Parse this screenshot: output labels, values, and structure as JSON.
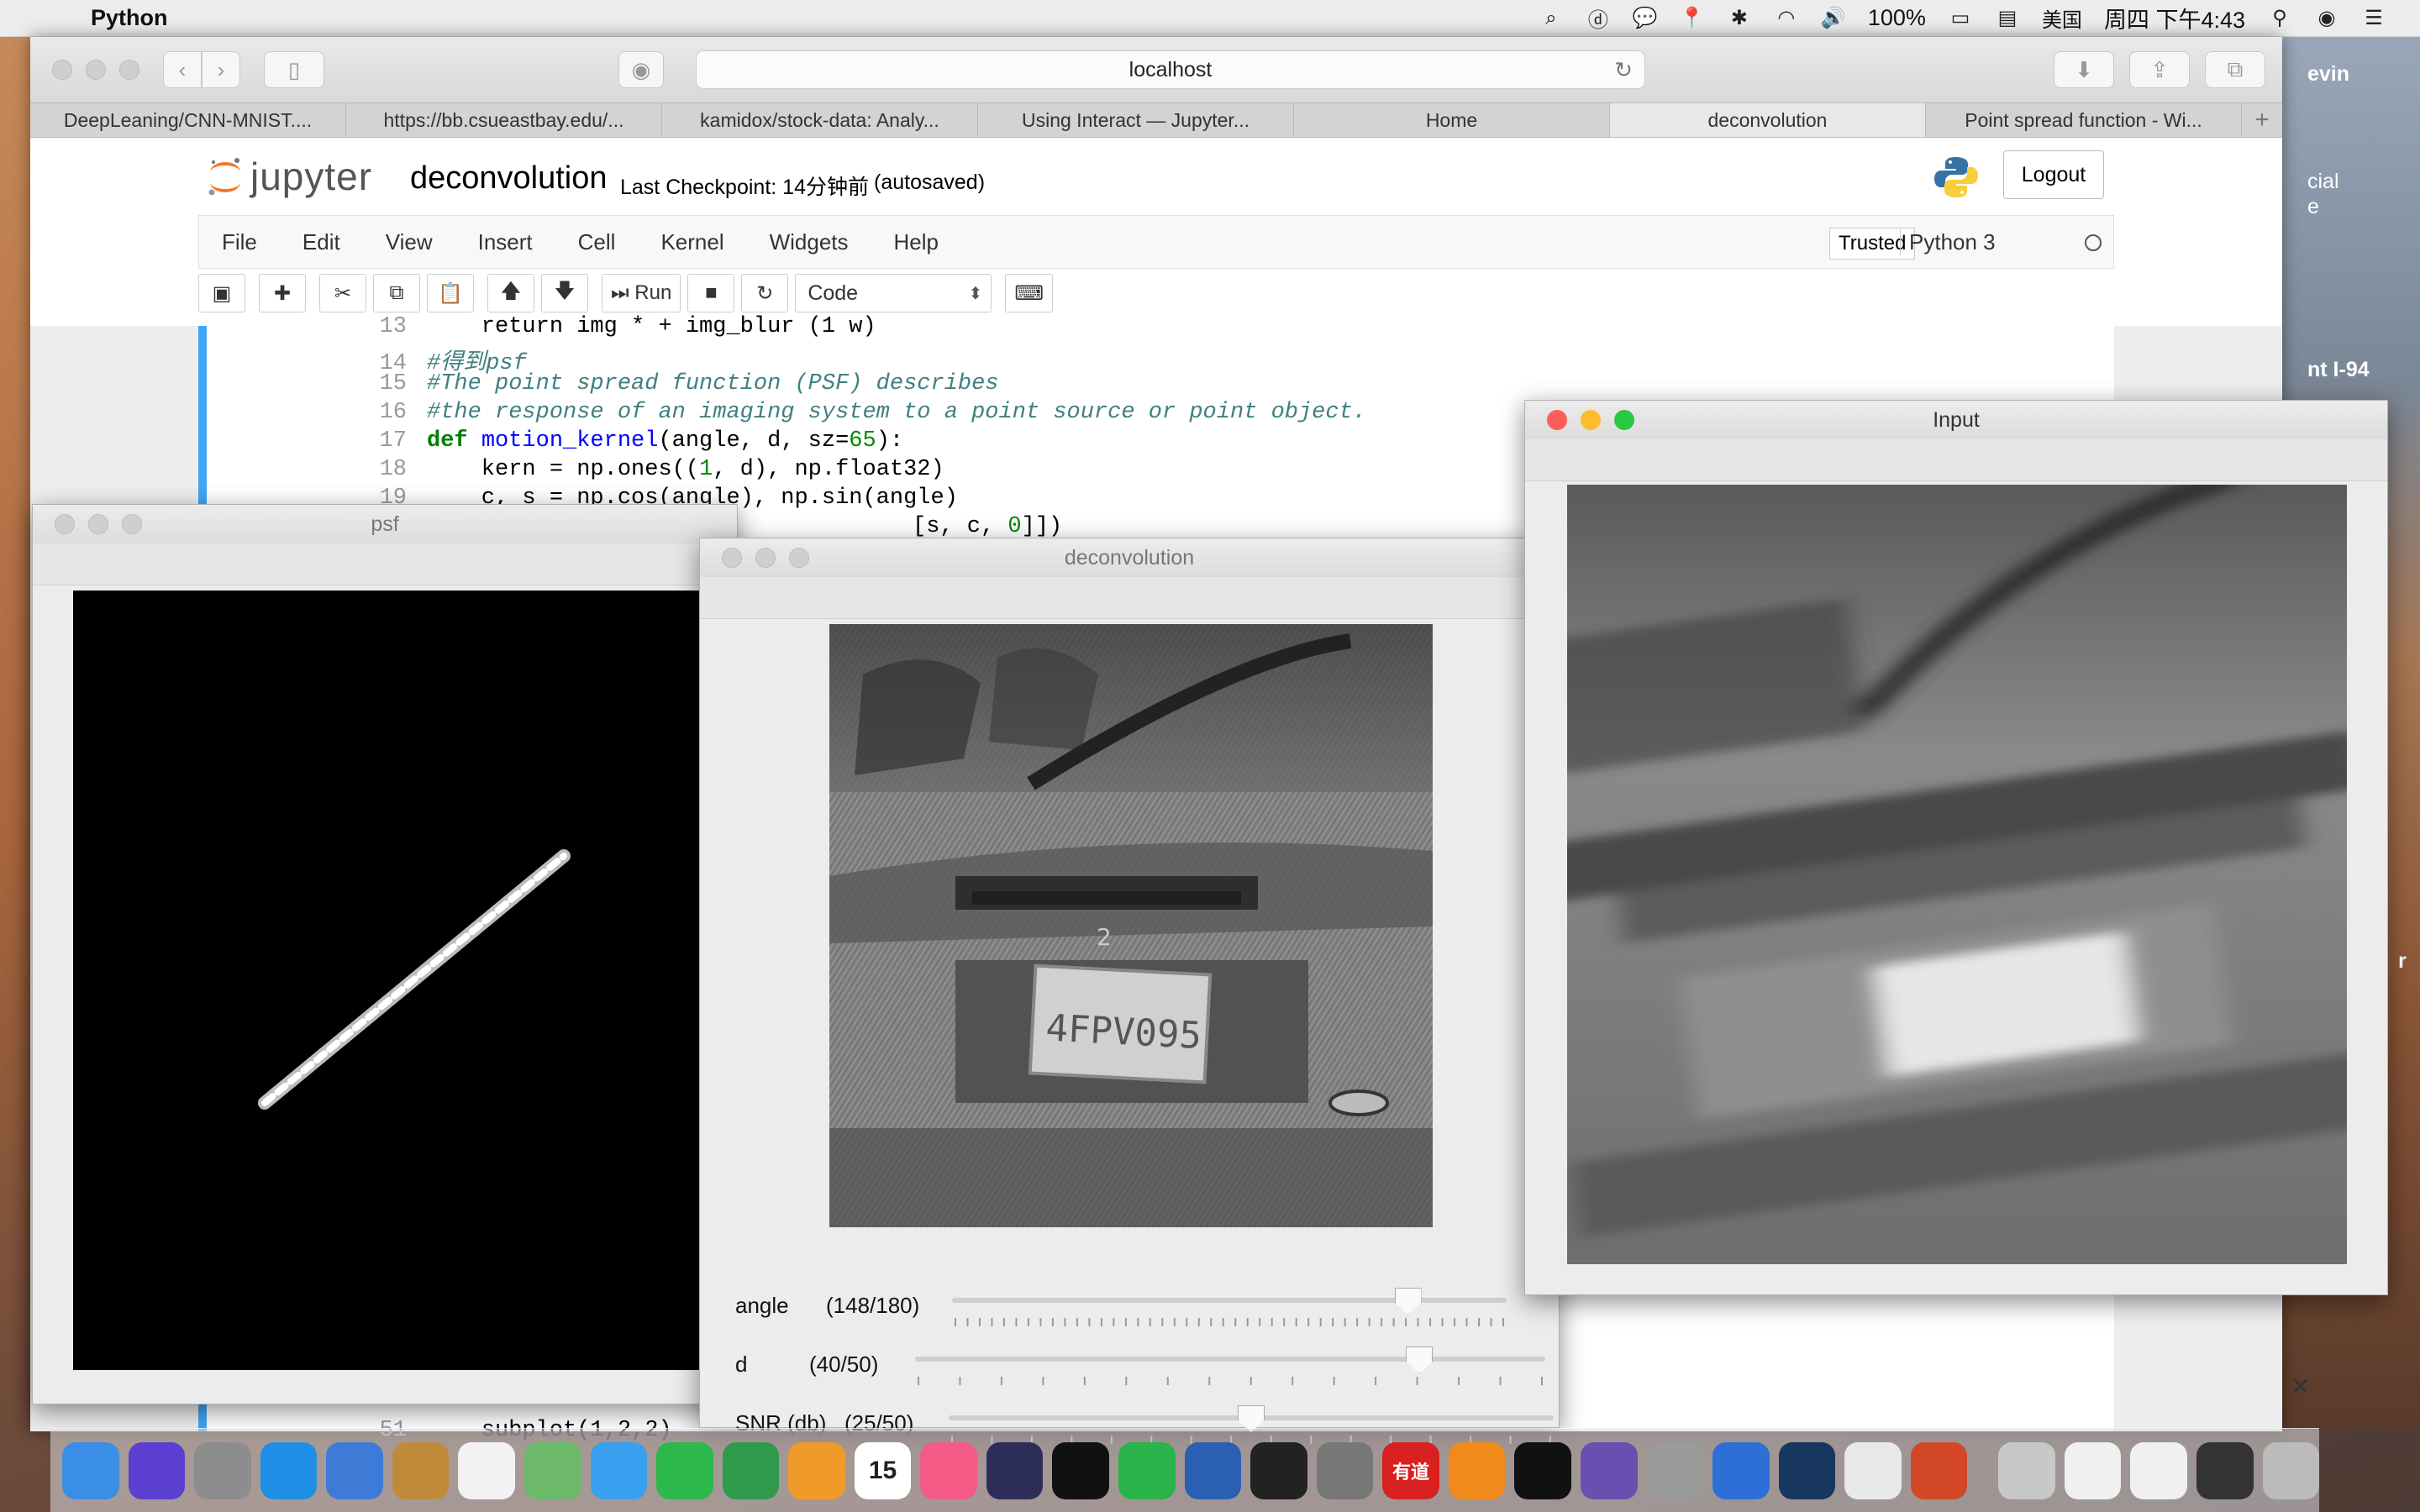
{
  "menubar": {
    "app_name": "Python",
    "battery": "100%",
    "input_method": "美国",
    "clock": "周四 下午4:43"
  },
  "safari": {
    "address": "localhost",
    "tabs": [
      {
        "label": "DeepLeaning/CNN-MNIST...."
      },
      {
        "label": "https://bb.csueastbay.edu/..."
      },
      {
        "label": "kamidox/stock-data: Analy..."
      },
      {
        "label": "Using Interact — Jupyter..."
      },
      {
        "label": "Home"
      },
      {
        "label": "deconvolution"
      },
      {
        "label": "Point spread function - Wi..."
      }
    ]
  },
  "desktop_peek": {
    "line1": "evin",
    "line2": "cial",
    "line3": "e",
    "line4": "nt I-94",
    "line5": "r"
  },
  "jupyter": {
    "logo_text": "jupyter",
    "notebook_title": "deconvolution",
    "checkpoint": "Last Checkpoint: 14分钟前",
    "autosaved": "(autosaved)",
    "logout": "Logout",
    "menu": [
      "File",
      "Edit",
      "View",
      "Insert",
      "Cell",
      "Kernel",
      "Widgets",
      "Help"
    ],
    "trusted": "Trusted",
    "kernel": "Python 3",
    "toolbar": {
      "run_label": "Run",
      "cell_type": "Code"
    }
  },
  "code": {
    "l13": {
      "n": "13",
      "text": "    return img * + img_blur (1 w)"
    },
    "l14": {
      "n": "14",
      "text": "#得到psf"
    },
    "l15": {
      "n": "15",
      "text": "#The point spread function (PSF) describes"
    },
    "l16": {
      "n": "16",
      "text": "#the response of an imaging system to a point source or point object."
    },
    "l17": {
      "n": "17",
      "kw": "def",
      "fn": "motion_kernel",
      "rest": "(angle, d, sz=",
      "num": "65",
      "end": "):"
    },
    "l18": {
      "n": "18",
      "pre": "    kern = np.ones((",
      "num": "1",
      "post": ", d), np.float32)"
    },
    "l19": {
      "n": "19",
      "text": "    c, s = np.cos(angle), np.sin(angle)"
    },
    "l20": {
      "text_pre": "[s, c, ",
      "num": "0",
      "text_post": "]])"
    },
    "l51": {
      "n": "51",
      "text": "    subplot(1,2,2)"
    }
  },
  "windows": {
    "psf": {
      "title": "psf"
    },
    "deconvolution": {
      "title": "deconvolution",
      "sliders": [
        {
          "label": "angle",
          "value": "(148/180)",
          "fraction": 0.822
        },
        {
          "label": "d",
          "value": "(40/50)",
          "fraction": 0.8
        },
        {
          "label": "SNR (db)",
          "value": "(25/50)",
          "fraction": 0.5
        }
      ]
    },
    "input": {
      "title": "Input"
    }
  },
  "plate_text": "4FPV095",
  "dock_icons": [
    "finder-icon",
    "siri-icon",
    "launchpad-icon",
    "safari-icon",
    "keynote-icon",
    "preview-icon",
    "photos-icon",
    "maps-icon",
    "messages-icon",
    "facetime-icon",
    "numbers-icon",
    "pages-icon",
    "calendar-icon",
    "itunes-icon",
    "eclipse-icon",
    "qq-icon",
    "wechat-icon",
    "word-icon",
    "activity-monitor-icon",
    "system-preferences-icon",
    "youdao-icon",
    "sublime-icon",
    "terminal-icon",
    "github-icon",
    "image-capture-icon",
    "xcode-icon",
    "steam-icon",
    "chrome-icon",
    "powerpoint-icon",
    "rocket-icon",
    "document-icon",
    "document2-icon",
    "screenshot-icon",
    "trash-icon"
  ],
  "dock_labels": {
    "calendar_day": "15",
    "youdao": "有道"
  }
}
